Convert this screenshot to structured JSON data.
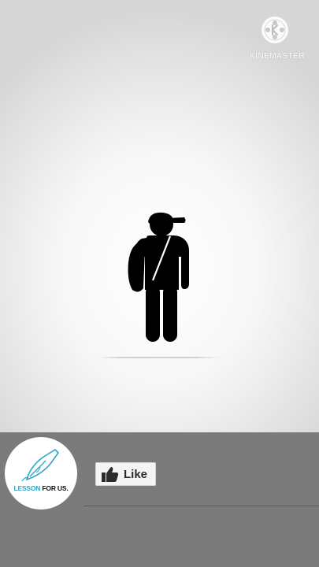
{
  "watermark": {
    "text": "KINEMASTER",
    "icon": "kinemaster-logo"
  },
  "scene": {
    "figure_icon": "person-with-cap-and-bag-icon"
  },
  "branding": {
    "part1": "LESSON",
    "part2": "FOR US.",
    "icon": "fountain-pen-logo",
    "accent": "#2aa5c9"
  },
  "like_button": {
    "label": "Like",
    "icon": "thumbs-up-icon"
  },
  "colors": {
    "bottom_bar": "#7b7b7b",
    "figure": "#000000",
    "background": "#f2f2f2"
  }
}
